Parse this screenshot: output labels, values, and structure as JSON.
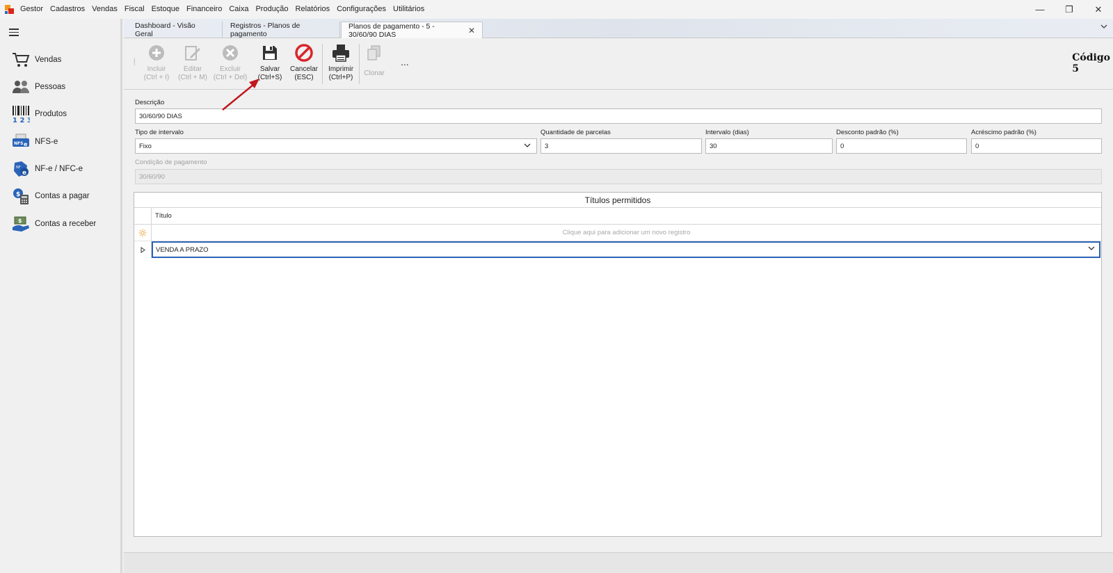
{
  "menu": {
    "items": [
      "Gestor",
      "Cadastros",
      "Vendas",
      "Fiscal",
      "Estoque",
      "Financeiro",
      "Caixa",
      "Produção",
      "Relatórios",
      "Configurações",
      "Utilitários"
    ]
  },
  "window_controls": {
    "minimize": "—",
    "restore": "❐",
    "close": "✕"
  },
  "sidebar": {
    "items": [
      {
        "label": "Vendas",
        "icon": "cart-icon"
      },
      {
        "label": "Pessoas",
        "icon": "people-icon"
      },
      {
        "label": "Produtos",
        "icon": "barcode-icon"
      },
      {
        "label": "NFS-e",
        "icon": "nfse-icon"
      },
      {
        "label": "NF-e / NFC-e",
        "icon": "nfe-icon"
      },
      {
        "label": "Contas a pagar",
        "icon": "bills-pay-icon"
      },
      {
        "label": "Contas a receber",
        "icon": "bills-receive-icon"
      }
    ]
  },
  "tabs": [
    {
      "label": "Dashboard - Visão Geral"
    },
    {
      "label": "Registros - Planos de pagamento"
    },
    {
      "label": "Planos de pagamento - 5 - 30/60/90 DIAS",
      "active": true,
      "close": "✕"
    }
  ],
  "toolbar": {
    "incluir": {
      "label": "Incluir",
      "shortcut": "(Ctrl + I)"
    },
    "editar": {
      "label": "Editar",
      "shortcut": "(Ctrl + M)"
    },
    "excluir": {
      "label": "Excluir",
      "shortcut": "(Ctrl + Del)"
    },
    "salvar": {
      "label": "Salvar",
      "shortcut": "(Ctrl+S)"
    },
    "cancelar": {
      "label": "Cancelar",
      "shortcut": "(ESC)"
    },
    "imprimir": {
      "label": "Imprimir",
      "shortcut": "(Ctrl+P)"
    },
    "clonar": {
      "label": "Clonar"
    },
    "more": "...",
    "codigo_label": "Código",
    "codigo_value": "5"
  },
  "form": {
    "descricao": {
      "label": "Descrição",
      "value": "30/60/90 DIAS"
    },
    "tipo_intervalo": {
      "label": "Tipo de intervalo",
      "value": "Fixo"
    },
    "quantidade_parcelas": {
      "label": "Quantidade de parcelas",
      "value": "3"
    },
    "intervalo_dias": {
      "label": "Intervalo (dias)",
      "value": "30"
    },
    "desconto_padrao": {
      "label": "Desconto padrão (%)",
      "value": "0"
    },
    "acrescimo_padrao": {
      "label": "Acréscimo padrão (%)",
      "value": "0"
    },
    "condicao_pagamento": {
      "label": "Condição de pagamento",
      "value": "30/60/90"
    }
  },
  "grid": {
    "title": "Títulos permitidos",
    "column": "Título",
    "new_row_hint": "Clique aqui para adicionar um novo registro",
    "rows": [
      {
        "titulo": "VENDA A PRAZO"
      }
    ]
  },
  "colors": {
    "accent_blue": "#2b63b6",
    "cancel_red": "#d9262c",
    "arrow_red": "#c0181f"
  }
}
